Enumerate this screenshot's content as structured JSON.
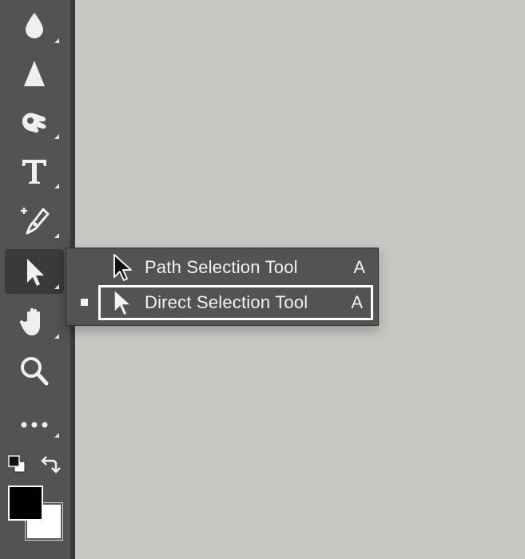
{
  "toolbar": {
    "tools": [
      {
        "name": "blur-tool",
        "icon": "droplet-icon"
      },
      {
        "name": "sharpen-tool",
        "icon": "triangle-icon"
      },
      {
        "name": "smudge-tool",
        "icon": "smudge-hand-icon"
      },
      {
        "name": "type-tool",
        "icon": "type-t-icon"
      },
      {
        "name": "pen-tool",
        "icon": "pen-nib-icon"
      },
      {
        "name": "selection-tool",
        "icon": "arrow-cursor-icon",
        "active": true
      },
      {
        "name": "hand-tool",
        "icon": "hand-icon"
      },
      {
        "name": "zoom-tool",
        "icon": "magnifier-icon"
      },
      {
        "name": "more-tools",
        "icon": "ellipsis-icon"
      }
    ],
    "colors": {
      "foreground": "#000000",
      "background": "#ffffff"
    }
  },
  "flyout": {
    "items": [
      {
        "label": "Path Selection Tool",
        "shortcut": "A",
        "selected": false
      },
      {
        "label": "Direct Selection Tool",
        "shortcut": "A",
        "selected": true
      }
    ]
  },
  "theme": {
    "panel": "#535353",
    "canvas": "#c9c7c4",
    "text": "#f2f2f2"
  }
}
